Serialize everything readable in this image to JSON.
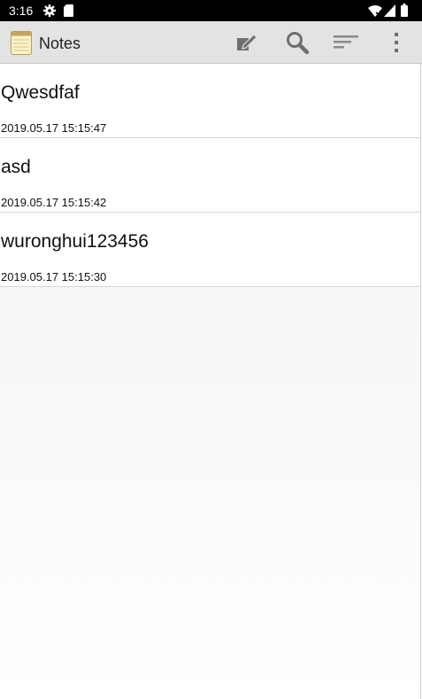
{
  "status_bar": {
    "time": "3:16",
    "icons": [
      "gear-icon",
      "sd-card-icon",
      "wifi-icon",
      "signal-icon",
      "battery-icon"
    ]
  },
  "app_bar": {
    "title": "Notes",
    "app_icon": "notepad-icon",
    "background": "#e3e3e3",
    "actions": [
      "new-note-icon",
      "search-icon",
      "sort-icon",
      "overflow-menu-icon"
    ]
  },
  "notes": [
    {
      "title": "Qwesdfaf",
      "date": "2019.05.17 15:15:47"
    },
    {
      "title": "asd",
      "date": "2019.05.17 15:15:42"
    },
    {
      "title": "wuronghui123456",
      "date": "2019.05.17 15:15:30"
    }
  ]
}
